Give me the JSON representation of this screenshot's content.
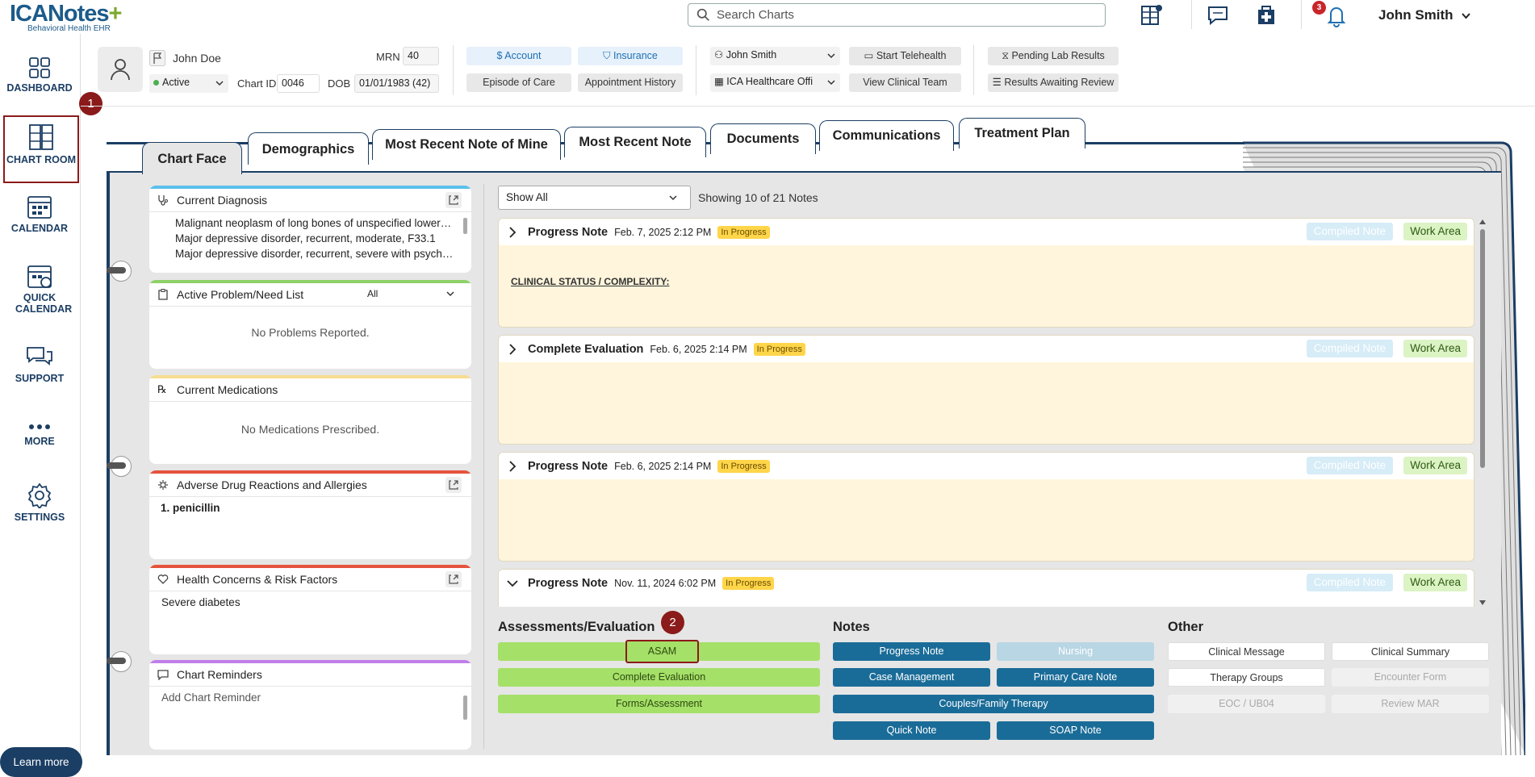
{
  "app": {
    "logo_main": "ICANotes",
    "logo_plus": "+",
    "logo_sub": "Behavioral Health EHR",
    "search_placeholder": "Search Charts",
    "notification_count": "3",
    "user_name": "John Smith"
  },
  "sidebar": {
    "items": [
      {
        "label": "DASHBOARD",
        "icon": "dashboard-icon"
      },
      {
        "label": "CHART ROOM",
        "icon": "file-cabinet-icon"
      },
      {
        "label": "CALENDAR",
        "icon": "calendar-icon"
      },
      {
        "label": "QUICK CALENDAR",
        "icon": "quick-calendar-icon"
      },
      {
        "label": "SUPPORT",
        "icon": "chat-bubbles-icon"
      },
      {
        "label": "MORE",
        "icon": "more-dots-icon"
      },
      {
        "label": "SETTINGS",
        "icon": "gear-icon"
      }
    ],
    "learn_more": "Learn more"
  },
  "markers": {
    "one": "1",
    "two": "2"
  },
  "patient": {
    "name": "John Doe",
    "status": "Active",
    "mrn_label": "MRN",
    "mrn": "40",
    "chart_id_label": "Chart ID",
    "chart_id": "0046",
    "dob_label": "DOB",
    "dob": "01/01/1983 (42)",
    "account": "Account",
    "insurance": "Insurance",
    "episode_of_care": "Episode of Care",
    "appointment_history": "Appointment History",
    "provider": "John Smith",
    "facility": "ICA Healthcare Offi",
    "start_telehealth": "Start Telehealth",
    "view_clinical_team": "View Clinical Team",
    "pending_lab_results": "Pending Lab Results",
    "results_awaiting_review": "Results Awaiting Review"
  },
  "tabs": [
    "Chart Face",
    "Demographics",
    "Most Recent Note of Mine",
    "Most Recent Note",
    "Documents",
    "Communications",
    "Treatment Plan"
  ],
  "panels": {
    "diagnosis": {
      "title": "Current Diagnosis",
      "items": [
        "Malignant neoplasm of long bones of unspecified lower limb",
        "Major depressive disorder, recurrent, moderate, F33.1",
        "Major depressive disorder, recurrent, severe with psychotic features"
      ]
    },
    "problems": {
      "title": "Active Problem/Need List",
      "filter": "All",
      "empty": "No Problems Reported."
    },
    "medications": {
      "title": "Current Medications",
      "empty": "No Medications Prescribed."
    },
    "allergies": {
      "title": "Adverse Drug Reactions and Allergies",
      "items": [
        "penicillin"
      ]
    },
    "health": {
      "title": "Health Concerns & Risk Factors",
      "items": [
        "Severe diabetes"
      ]
    },
    "reminders": {
      "title": "Chart Reminders",
      "placeholder": "Add Chart Reminder"
    }
  },
  "notes_filter": "Show All",
  "notes_count": "Showing 10 of 21 Notes",
  "notes": [
    {
      "title": "Progress Note",
      "date": "Feb. 7, 2025 2:12 PM",
      "status": "In Progress",
      "compiled": "Compiled Note",
      "work_area": "Work Area",
      "body": "CLINICAL STATUS / COMPLEXITY:"
    },
    {
      "title": "Complete Evaluation",
      "date": "Feb. 6, 2025 2:14 PM",
      "status": "In Progress",
      "compiled": "Compiled Note",
      "work_area": "Work Area",
      "body": ""
    },
    {
      "title": "Progress Note",
      "date": "Feb. 6, 2025 2:14 PM",
      "status": "In Progress",
      "compiled": "Compiled Note",
      "work_area": "Work Area",
      "body": ""
    },
    {
      "title": "Progress Note",
      "date": "Nov. 11, 2024 6:02 PM",
      "status": "In Progress",
      "compiled": "Compiled Note",
      "work_area": "Work Area",
      "body": ""
    }
  ],
  "actions": {
    "assessments": {
      "title": "Assessments/Evaluation",
      "buttons": [
        "ASAM",
        "Complete Evaluation",
        "Forms/Assessment"
      ]
    },
    "notes": {
      "title": "Notes",
      "buttons": [
        "Progress Note",
        "Nursing",
        "Case Management",
        "Primary Care Note",
        "Couples/Family Therapy",
        "Quick Note",
        "SOAP Note"
      ]
    },
    "other": {
      "title": "Other",
      "buttons": [
        "Clinical Message",
        "Clinical Summary",
        "Therapy Groups",
        "Encounter Form",
        "EOC / UB04",
        "Review MAR"
      ]
    }
  },
  "colors": {
    "brand": "#1b3e64",
    "highlight": "#8b1a1a",
    "note_bg": "#fff5dc",
    "status": "#ffd54a",
    "green_btn": "#a5e068",
    "teal_btn": "#1a6c98"
  }
}
